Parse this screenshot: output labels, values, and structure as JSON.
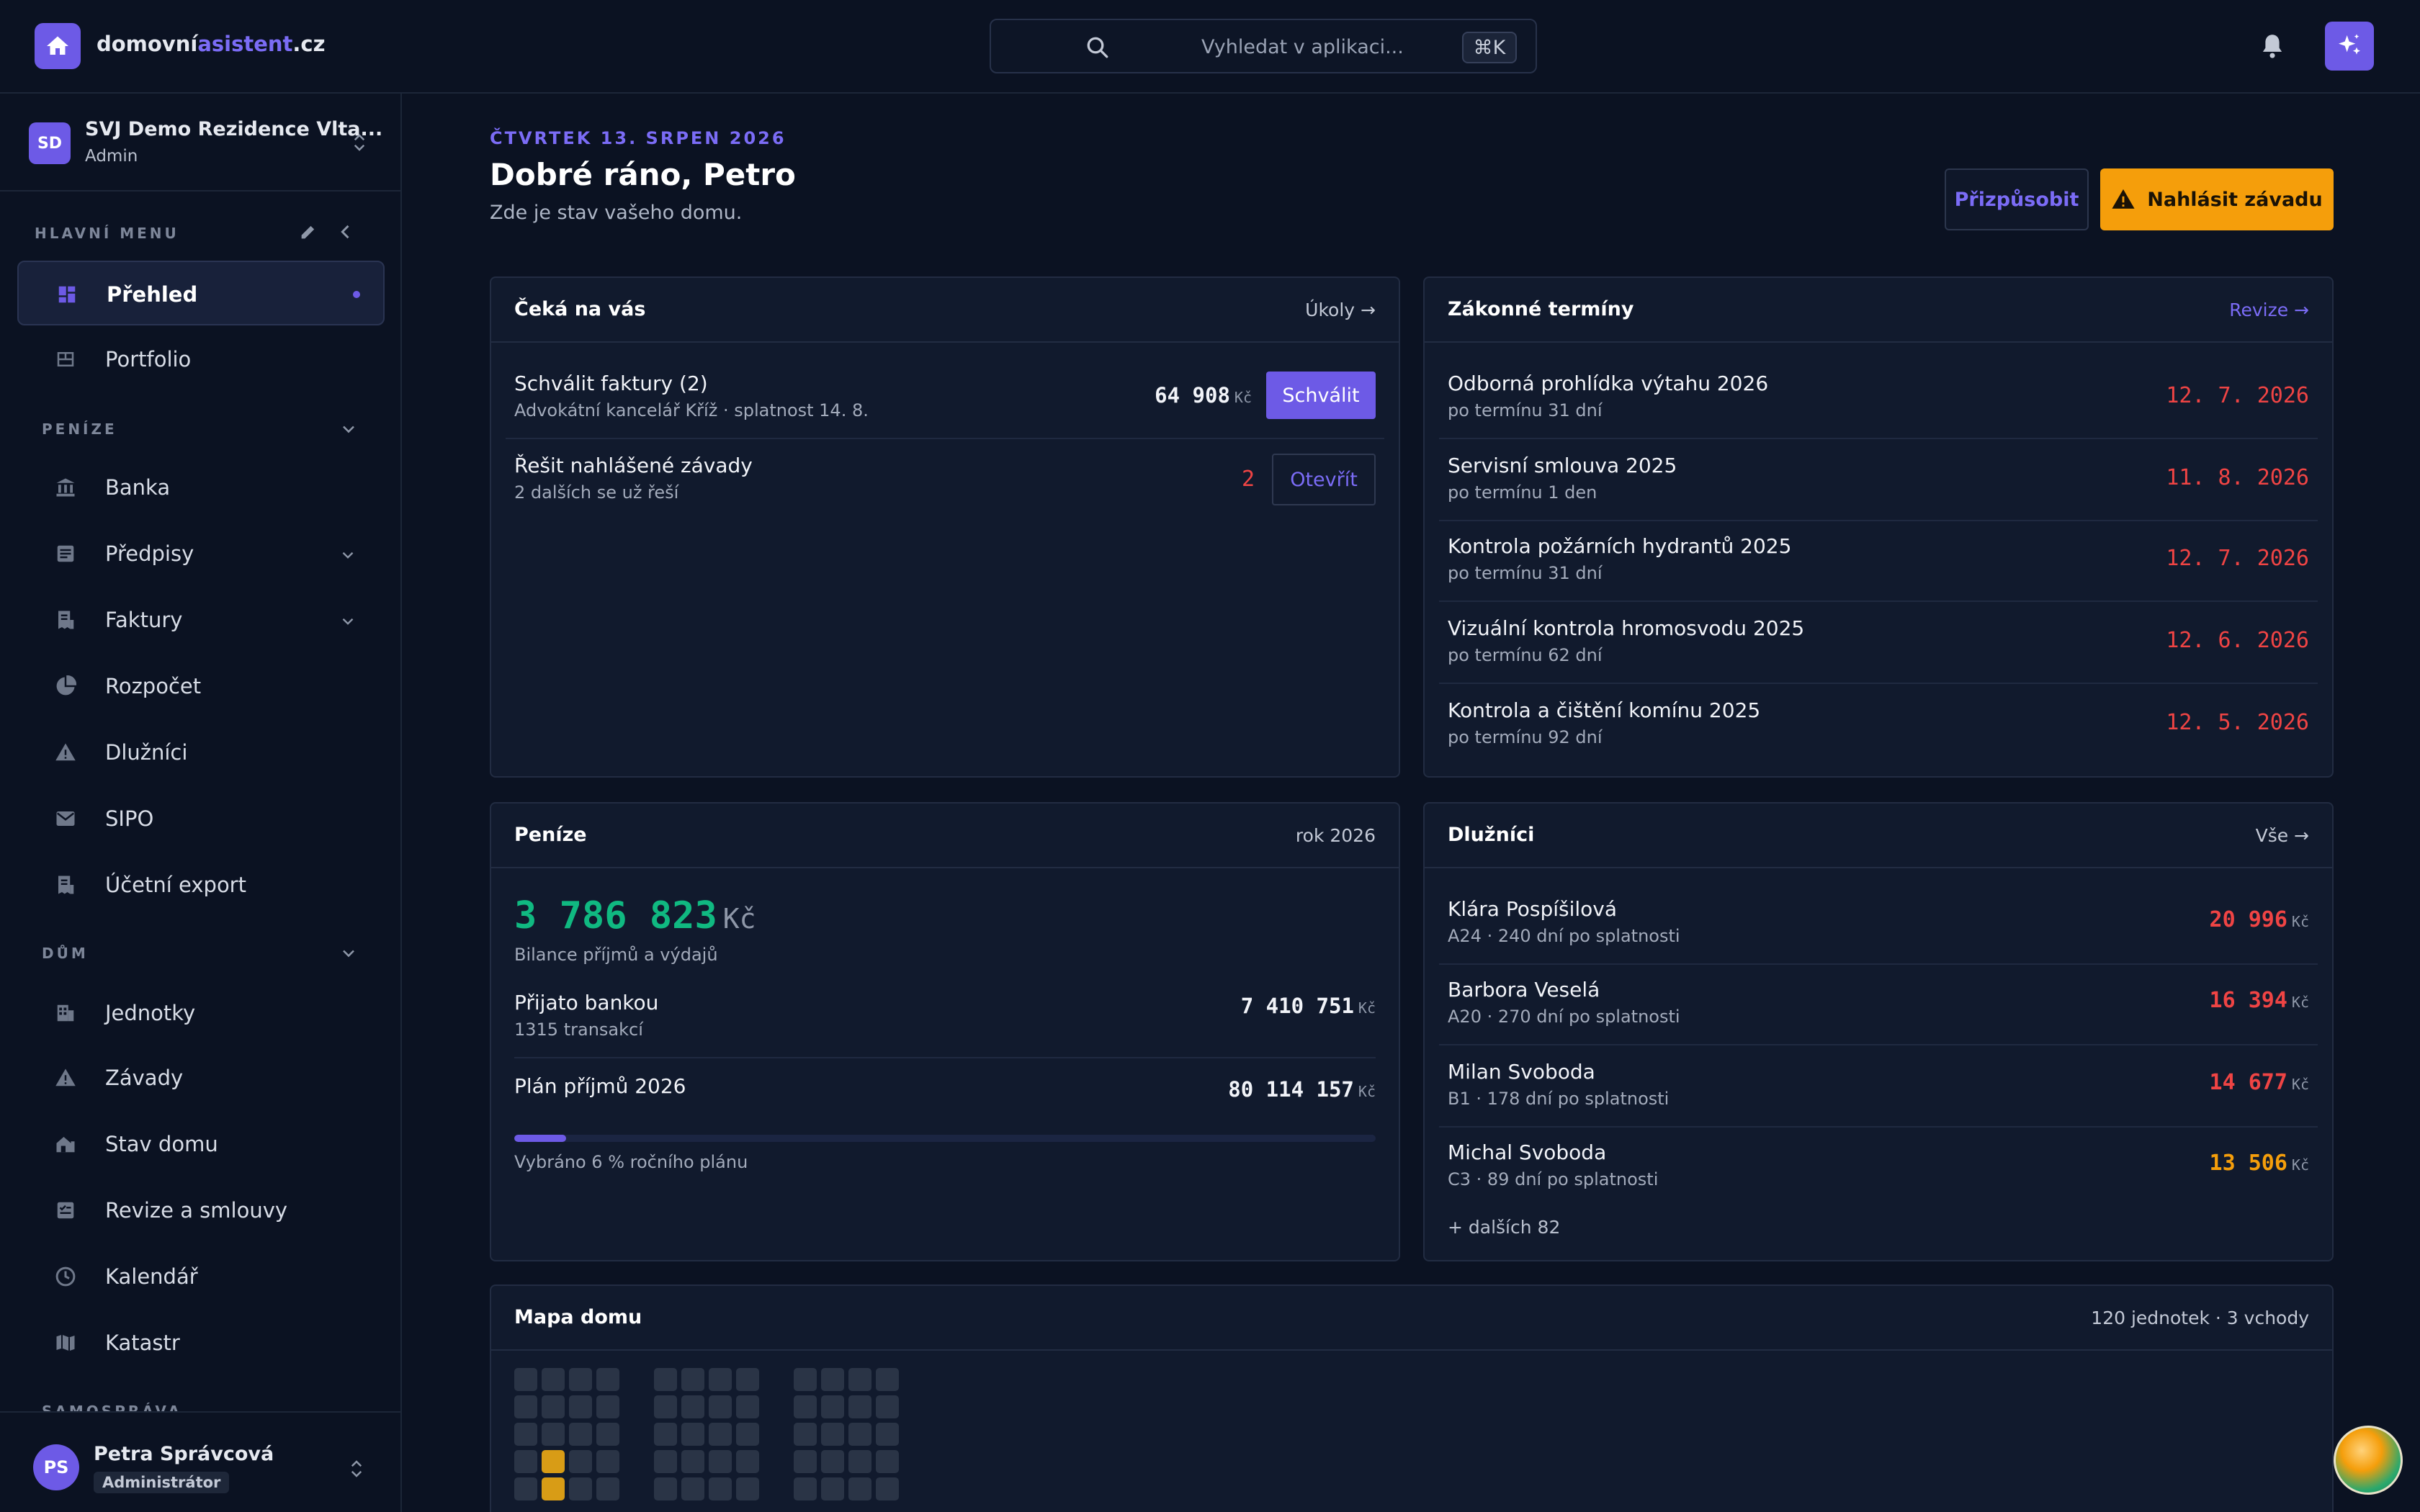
{
  "app": {
    "logo_part1": "domovní",
    "logo_part2": "asistent",
    "logo_part3": ".cz",
    "search_placeholder": "Vyhledat v aplikaci...",
    "search_shortcut": "⌘K",
    "icons": [
      "home-icon",
      "search-icon",
      "bell-icon",
      "sparkles-icon"
    ]
  },
  "org": {
    "initials": "SD",
    "name": "SVJ Demo Rezidence Vlta...",
    "role": "Admin"
  },
  "sidebar": {
    "main_menu_title": "HLAVNÍ MENU",
    "main_items": [
      {
        "label": "Přehled",
        "icon": "dashboard-icon",
        "active": true
      },
      {
        "label": "Portfolio",
        "icon": "portfolio-icon"
      }
    ],
    "money_title": "PENÍZE",
    "money_items": [
      {
        "label": "Banka",
        "icon": "bank-icon"
      },
      {
        "label": "Předpisy",
        "icon": "document-icon",
        "has_children": true
      },
      {
        "label": "Faktury",
        "icon": "invoice-icon",
        "has_children": true
      },
      {
        "label": "Rozpočet",
        "icon": "pie-chart-icon"
      },
      {
        "label": "Dlužníci",
        "icon": "warning-icon"
      },
      {
        "label": "SIPO",
        "icon": "mail-icon"
      },
      {
        "label": "Účetní export",
        "icon": "export-icon"
      }
    ],
    "house_title": "DŮM",
    "house_items": [
      {
        "label": "Jednotky",
        "icon": "building-icon"
      },
      {
        "label": "Závady",
        "icon": "warning-icon"
      },
      {
        "label": "Stav domu",
        "icon": "house-status-icon"
      },
      {
        "label": "Revize a smlouvy",
        "icon": "contract-icon"
      },
      {
        "label": "Kalendář",
        "icon": "clock-icon"
      },
      {
        "label": "Katastr",
        "icon": "map-icon"
      }
    ],
    "cut_section_title": "SAMOSPRÁVA"
  },
  "user": {
    "initials": "PS",
    "name": "Petra Správcová",
    "role": "Administrátor"
  },
  "header": {
    "date": "ČTVRTEK 13. SRPEN 2026",
    "greeting": "Dobré ráno, Petro",
    "subtitle": "Zde je stav vašeho domu.",
    "customize_label": "Přizpůsobit",
    "report_label": "Nahlásit závadu"
  },
  "tasks": {
    "title": "Čeká na vás",
    "link": "Úkoly →",
    "items": [
      {
        "title": "Schválit faktury (2)",
        "subtitle": "Advokátní kancelář Kříž · splatnost 14. 8.",
        "amount": "64 908",
        "currency": "Kč",
        "action": "Schválit"
      },
      {
        "title": "Řešit nahlášené závady",
        "subtitle": "2 dalších se už řeší",
        "count": "2",
        "action": "Otevřít"
      }
    ]
  },
  "deadlines": {
    "title": "Zákonné termíny",
    "link": "Revize →",
    "items": [
      {
        "title": "Odborná prohlídka výtahu 2026",
        "subtitle": "po termínu 31 dní",
        "date": "12. 7. 2026"
      },
      {
        "title": "Servisní smlouva 2025",
        "subtitle": "po termínu 1 den",
        "date": "11. 8. 2026"
      },
      {
        "title": "Kontrola požárních hydrantů 2025",
        "subtitle": "po termínu 31 dní",
        "date": "12. 7. 2026"
      },
      {
        "title": "Vizuální kontrola hromosvodu 2025",
        "subtitle": "po termínu 62 dní",
        "date": "12. 6. 2026"
      },
      {
        "title": "Kontrola a čištění komínu 2025",
        "subtitle": "po termínu 92 dní",
        "date": "12. 5. 2026"
      }
    ]
  },
  "money": {
    "title": "Peníze",
    "period": "rok 2026",
    "balance": "3 786 823",
    "currency": "Kč",
    "balance_label": "Bilance příjmů a výdajů",
    "received_title": "Přijato bankou",
    "received_sub": "1315 transakcí",
    "received_value": "7 410 751",
    "plan_title": "Plán příjmů 2026",
    "plan_value": "80 114 157",
    "progress_percent": 6,
    "progress_label": "Vybráno 6 % ročního plánu"
  },
  "debtors": {
    "title": "Dlužníci",
    "link": "Vše →",
    "items": [
      {
        "name": "Klára Pospíšilová",
        "subtitle": "A24 · 240 dní po splatnosti",
        "amount": "20 996",
        "severity": "red"
      },
      {
        "name": "Barbora Veselá",
        "subtitle": "A20 · 270 dní po splatnosti",
        "amount": "16 394",
        "severity": "red"
      },
      {
        "name": "Milan Svoboda",
        "subtitle": "B1 · 178 dní po splatnosti",
        "amount": "14 677",
        "severity": "red"
      },
      {
        "name": "Michal Svoboda",
        "subtitle": "C3 · 89 dní po splatnosti",
        "amount": "13 506",
        "severity": "orange"
      }
    ],
    "currency": "Kč",
    "more": "+ dalších 82"
  },
  "house_map": {
    "title": "Mapa domu",
    "summary": "120 jednotek · 3 vchody"
  },
  "colors": {
    "accent": "#6d5ae6",
    "warning": "#f59e0b",
    "danger": "#ef4444",
    "success": "#10b981"
  }
}
